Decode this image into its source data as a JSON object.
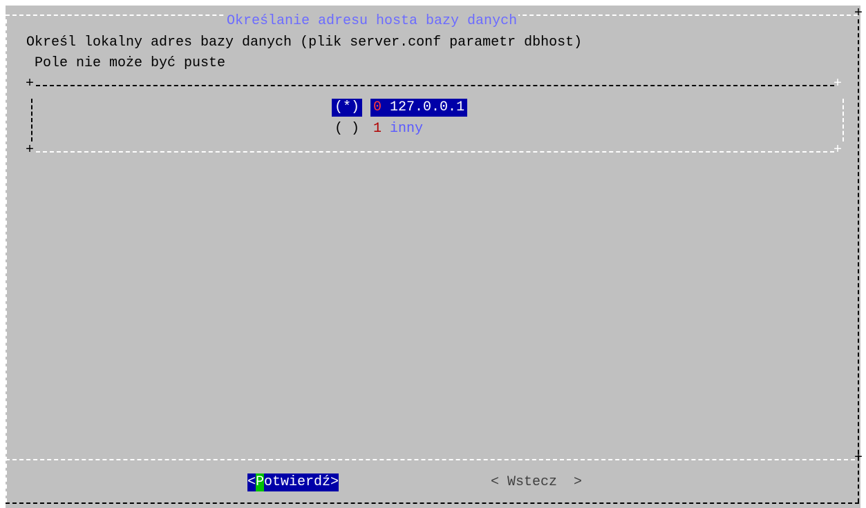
{
  "dialog": {
    "title": "Określanie adresu hosta bazy danych",
    "prompt": "Określ lokalny adres bazy danych (plik server.conf parametr dbhost)",
    "hint": "Pole nie może być puste"
  },
  "options": [
    {
      "mark": "(*)",
      "hotkey": "0",
      "label": "127.0.0.1",
      "selected": true
    },
    {
      "mark": "( )",
      "hotkey": "1",
      "label": "inny",
      "selected": false
    }
  ],
  "buttons": {
    "confirm": {
      "open": "<",
      "hotkey": "P",
      "rest": "otwierdź",
      "close": ">"
    },
    "back": {
      "label": "< Wstecz  >"
    }
  },
  "colors": {
    "dialog_bg": "#c0c0c0",
    "selection_bg": "#0000a8",
    "title": "#6b6bff",
    "hotkey_highlight": "#00c000"
  }
}
